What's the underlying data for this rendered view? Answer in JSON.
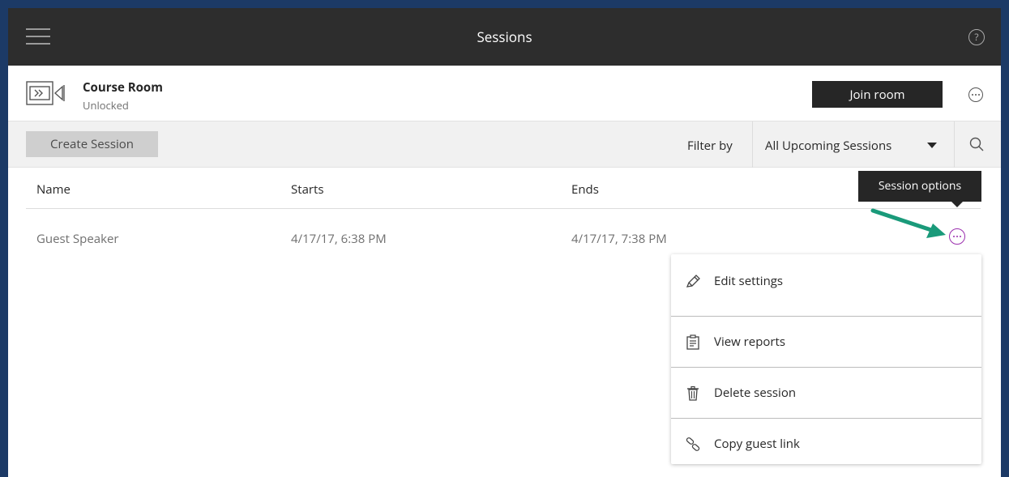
{
  "header": {
    "title": "Sessions",
    "menu_icon": "hamburger-menu-icon",
    "help_icon": "help-icon",
    "help_glyph": "?"
  },
  "room": {
    "name": "Course Room",
    "status": "Unlocked",
    "join_label": "Join room"
  },
  "toolbar": {
    "create_label": "Create Session",
    "filter_label": "Filter by",
    "filter_value": "All Upcoming Sessions"
  },
  "table": {
    "columns": [
      "Name",
      "Starts",
      "Ends"
    ],
    "rows": [
      {
        "name": "Guest Speaker",
        "starts": "4/17/17, 6:38 PM",
        "ends": "4/17/17, 7:38 PM"
      }
    ]
  },
  "tooltip": {
    "text": "Session options"
  },
  "menu": {
    "items": [
      {
        "label": "Edit settings",
        "icon": "pencil-icon"
      },
      {
        "label": "View reports",
        "icon": "report-icon"
      },
      {
        "label": "Delete session",
        "icon": "trash-icon"
      },
      {
        "label": "Copy guest link",
        "icon": "link-icon"
      }
    ]
  },
  "colors": {
    "header_bg": "#2d2d2d",
    "frame_border": "#1c3a66",
    "accent_purple": "#9b2fae",
    "arrow_green": "#1a9a7a"
  }
}
